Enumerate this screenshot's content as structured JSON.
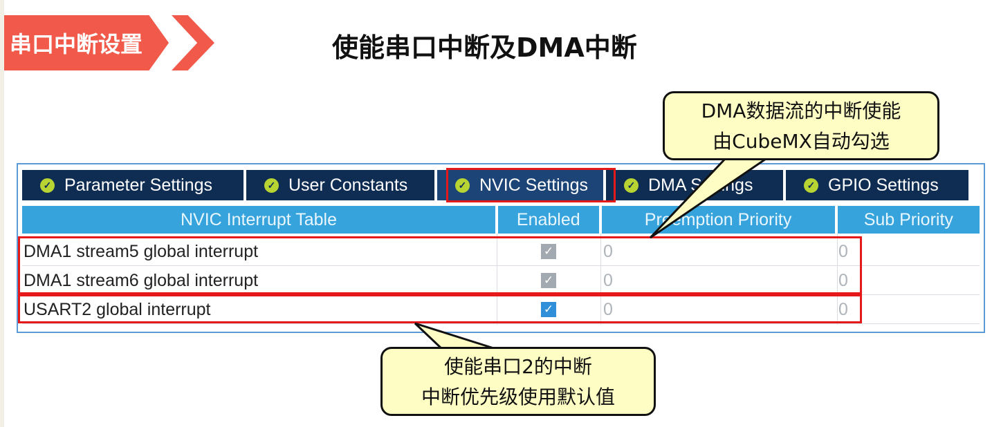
{
  "section_tag": "串口中断设置",
  "page_title": "使能串口中断及DMA中断",
  "tabs": [
    {
      "label": "Parameter Settings"
    },
    {
      "label": "User Constants"
    },
    {
      "label": "NVIC Settings",
      "active": true
    },
    {
      "label": "DMA Settings"
    },
    {
      "label": "GPIO Settings"
    }
  ],
  "table": {
    "headers": [
      "NVIC Interrupt Table",
      "Enabled",
      "Preemption Priority",
      "Sub Priority"
    ],
    "rows": [
      {
        "name": "DMA1 stream5 global interrupt",
        "enabled": true,
        "locked": true,
        "preemption": "0",
        "sub": "0"
      },
      {
        "name": "DMA1 stream6 global interrupt",
        "enabled": true,
        "locked": true,
        "preemption": "0",
        "sub": "0"
      },
      {
        "name": "USART2 global interrupt",
        "enabled": true,
        "locked": false,
        "preemption": "0",
        "sub": "0"
      }
    ]
  },
  "callout_top": {
    "line1": "DMA数据流的中断使能",
    "line2": "由CubeMX自动勾选"
  },
  "callout_bottom": {
    "line1": "使能串口2的中断",
    "line2": "中断优先级使用默认值"
  },
  "colors": {
    "accent": "#f15a4a",
    "tab_bg": "#0f2d52",
    "header_bg": "#37a3dc",
    "highlight": "#e5181a",
    "callout_bg": "#fefdc4"
  }
}
